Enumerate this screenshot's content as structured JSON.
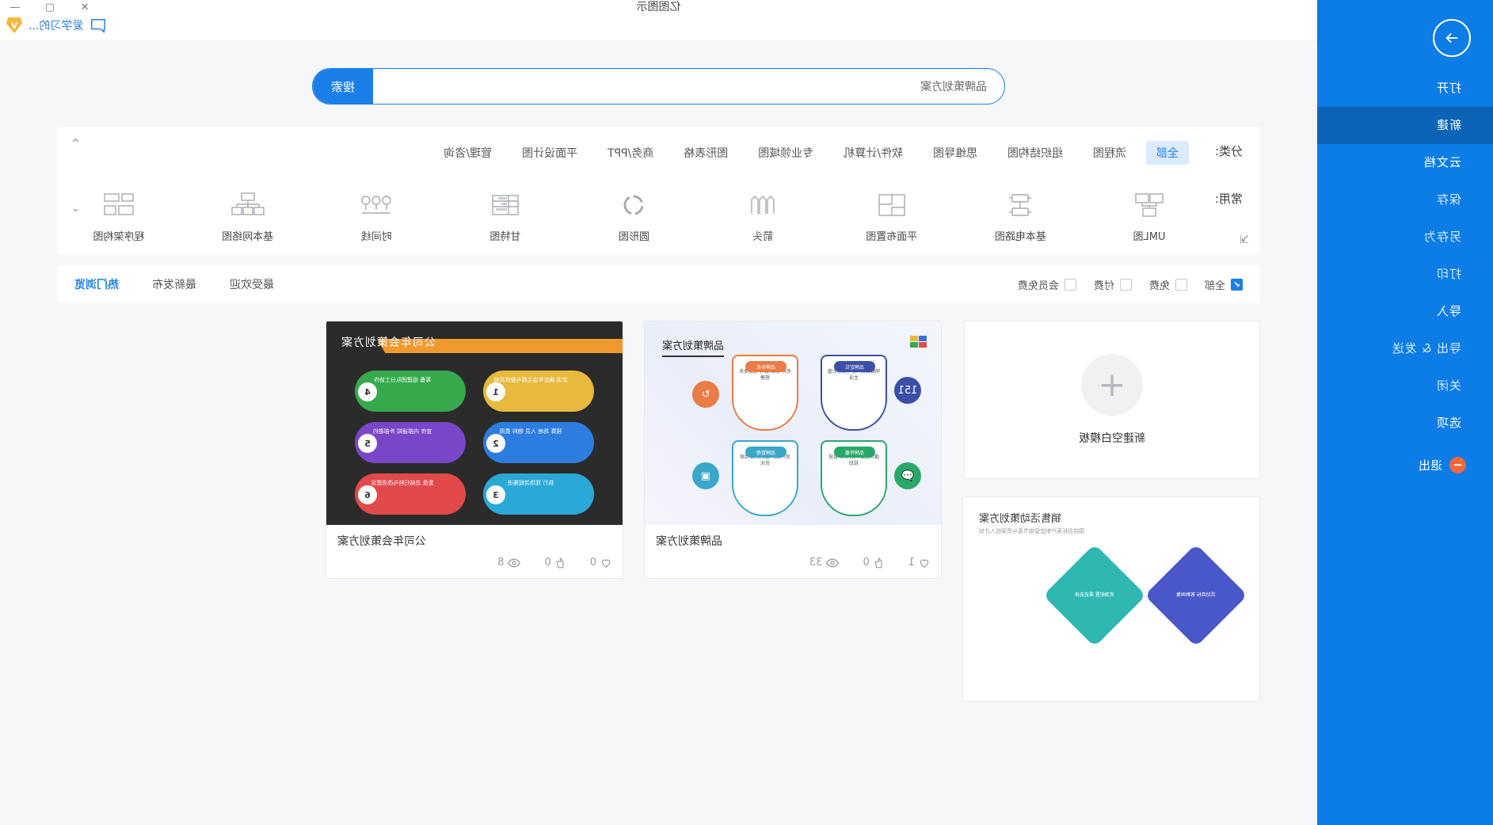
{
  "window": {
    "title": "亿图图示",
    "controls": {
      "minimize": "—",
      "maximize": "▢",
      "close": "✕"
    }
  },
  "account": {
    "badge_letter": "V",
    "user_name": "爱学习的...",
    "message_icon": "message-icon"
  },
  "search": {
    "placeholder": "品牌策划方案",
    "value": "品牌策划方案",
    "button_label": "搜索"
  },
  "sidebar": {
    "back_icon": "arrow-right-icon",
    "items": [
      {
        "label": "打开",
        "active": false,
        "dim": false
      },
      {
        "label": "新建",
        "active": true,
        "dim": false
      },
      {
        "label": "云文档",
        "active": false,
        "dim": false
      },
      {
        "label": "保存",
        "active": false,
        "dim": true
      },
      {
        "label": "另存为",
        "active": false,
        "dim": true
      },
      {
        "label": "打印",
        "active": false,
        "dim": true
      },
      {
        "label": "导入",
        "active": false,
        "dim": false
      },
      {
        "label": "导出 & 发送",
        "active": false,
        "dim": true
      },
      {
        "label": "关闭",
        "active": false,
        "dim": true
      },
      {
        "label": "选项",
        "active": false,
        "dim": false
      }
    ],
    "exit": {
      "label": "退出",
      "icon": "exit-icon",
      "color": "#f0683c"
    }
  },
  "categories": {
    "label": "分类:",
    "items": [
      {
        "label": "全部",
        "selected": true
      },
      {
        "label": "流程图",
        "selected": false
      },
      {
        "label": "组织结构图",
        "selected": false
      },
      {
        "label": "思维导图",
        "selected": false
      },
      {
        "label": "软件/计算机",
        "selected": false
      },
      {
        "label": "专业领域图",
        "selected": false
      },
      {
        "label": "图形表格",
        "selected": false
      },
      {
        "label": "商务/PPT",
        "selected": false
      },
      {
        "label": "平面设计图",
        "selected": false
      },
      {
        "label": "管理/咨询",
        "selected": false
      }
    ],
    "collapse_icon": "chevron-up-icon"
  },
  "common": {
    "label": "常用:",
    "expand_icon": "chevron-down-icon",
    "corner_icon": "expand-icon",
    "items": [
      {
        "label": "UML图",
        "icon": "uml-diagram-icon"
      },
      {
        "label": "基本电路图",
        "icon": "circuit-diagram-icon"
      },
      {
        "label": "平面布置图",
        "icon": "floor-plan-icon"
      },
      {
        "label": "箭头",
        "icon": "arrow-icon"
      },
      {
        "label": "圆形图",
        "icon": "donut-chart-icon"
      },
      {
        "label": "甘特图",
        "icon": "gantt-chart-icon"
      },
      {
        "label": "时间线",
        "icon": "timeline-icon"
      },
      {
        "label": "基本网络图",
        "icon": "network-diagram-icon"
      },
      {
        "label": "程序架构图",
        "icon": "program-architecture-icon"
      }
    ]
  },
  "filterbar": {
    "sorts": [
      {
        "label": "热门浏览",
        "active": true
      },
      {
        "label": "最新发布",
        "active": false
      },
      {
        "label": "最受欢迎",
        "active": false
      }
    ],
    "checks": [
      {
        "label": "全部",
        "checked": true
      },
      {
        "label": "免费",
        "checked": false
      },
      {
        "label": "付费",
        "checked": false
      },
      {
        "label": "会员免费",
        "checked": false
      }
    ],
    "check_glyph": "✔"
  },
  "templates": {
    "new_blank": {
      "label": "新建空白模板",
      "plus": "+"
    },
    "cards": [
      {
        "title": "公司年会策划方案",
        "thumb_title": "公司年会策划方案",
        "views": "8",
        "likes": "0",
        "favs": "0",
        "view_icon": "eye-icon",
        "like_icon": "thumbs-up-icon",
        "fav_icon": "heart-icon",
        "nodes": [
          {
            "n": "1",
            "text": "定调\n确定年会主题与整体风格",
            "color": "#e8b93c"
          },
          {
            "n": "2",
            "text": "预算\n场地 人员 物料 费用",
            "color": "#2d7de0"
          },
          {
            "n": "3",
            "text": "执行\n现场流程推进",
            "color": "#2aa8d8"
          },
          {
            "n": "4",
            "text": "筹备\n组建团队分工协作",
            "color": "#36a94d"
          },
          {
            "n": "5",
            "text": "宣传\n内部通知 外部邀约",
            "color": "#7a46c9"
          },
          {
            "n": "6",
            "text": "复盘\n总结归档与改进建议",
            "color": "#e2494b"
          }
        ]
      },
      {
        "title": "品牌策划方案",
        "thumb_title": "品牌策划方案",
        "views": "33",
        "likes": "0",
        "favs": "1",
        "view_icon": "eye-icon",
        "like_icon": "thumbs-up-icon",
        "fav_icon": "heart-icon",
        "shields": [
          {
            "cap": "品牌定位",
            "text": "明确目标人群与核心价值主张",
            "color": "#3b4fa8"
          },
          {
            "cap": "品牌命名",
            "text": "名称 标识 口号 视觉体系搭建",
            "color": "#ea7c45"
          },
          {
            "cap": "品牌传播",
            "text": "媒介组合 内容节奏 投放规划",
            "color": "#2aa86a"
          },
          {
            "cap": "品牌管理",
            "text": "资产维护 监测评估 持续优化",
            "color": "#3aa7c9"
          }
        ],
        "bubbles": [
          {
            "glyph": "151",
            "color": "#3b4fa8"
          },
          {
            "glyph": "↻",
            "color": "#ea7c45"
          },
          {
            "glyph": "💬",
            "color": "#2aa86a"
          },
          {
            "glyph": "▣",
            "color": "#3aa7c9"
          }
        ]
      },
      {
        "title": "销售活动策划方案",
        "thumb_title": "销售活动策划方案",
        "subtitle": "围绕目标客户制定促销节奏与资源投入计划",
        "diamonds": [
          {
            "text": "活动目标 客群画像",
            "color": "#4a57c8"
          },
          {
            "text": "资源配置 渠道选择",
            "color": "#2fb7b1"
          }
        ]
      }
    ]
  }
}
